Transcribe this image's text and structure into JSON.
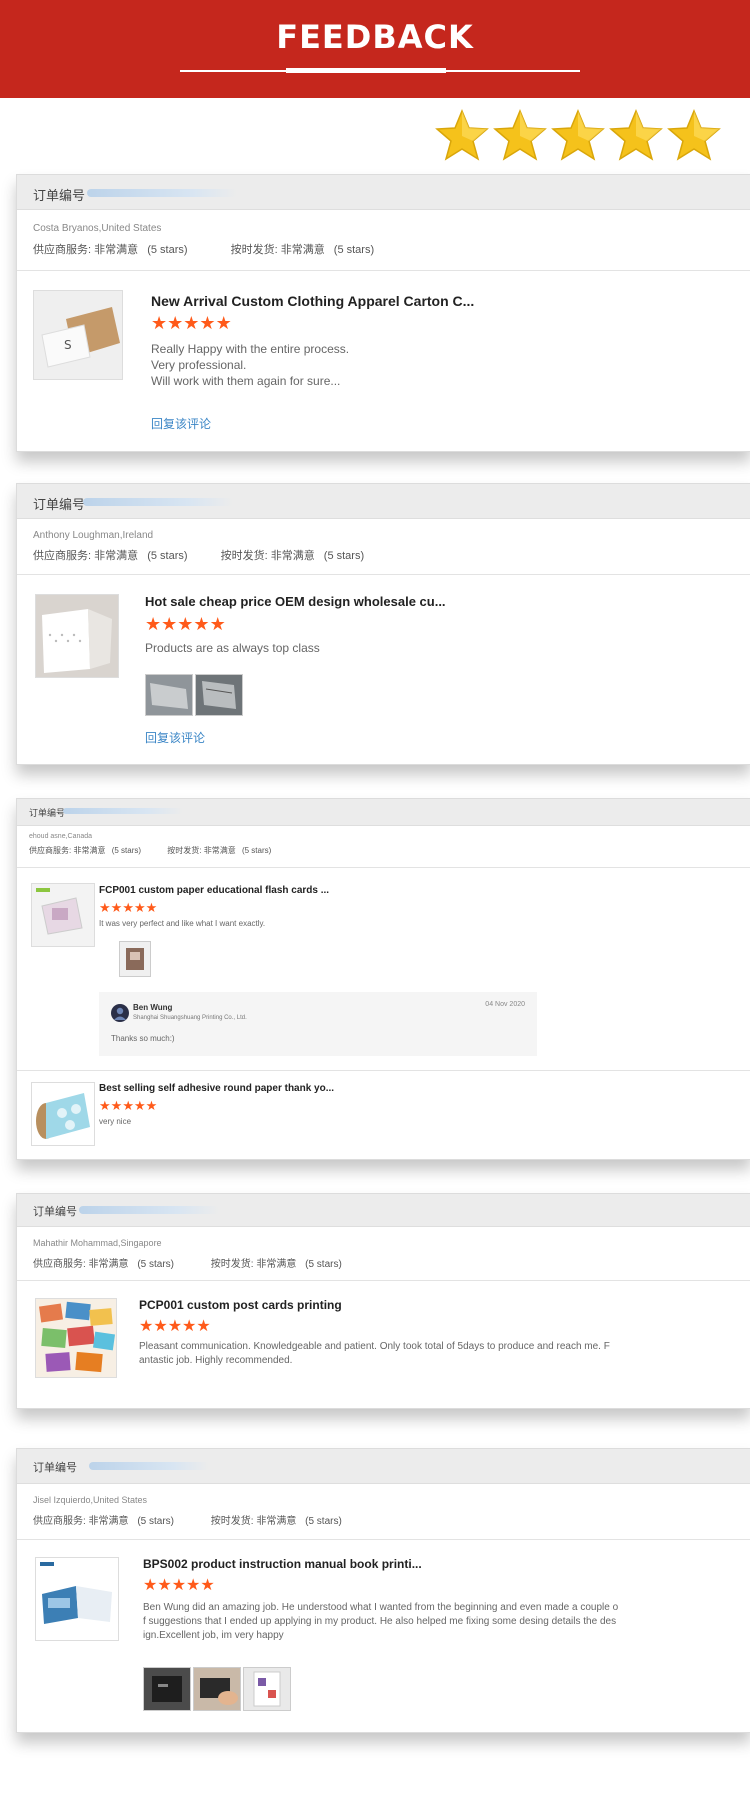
{
  "header": {
    "title": "FEEDBACK"
  },
  "colors": {
    "banner": "#c5271d",
    "star_gold": "#f5c21b",
    "star_orange": "#ff5a1a",
    "link": "#3b86c6"
  },
  "overall_rating": {
    "stars": 5,
    "max": 5
  },
  "order_label": "订单编号",
  "reviews": [
    {
      "buyer": "Costa Bryanos,United States",
      "supplier_service": "供应商服务: 非常满意",
      "supplier_stars": "(5 stars)",
      "shipping": "按时发货: 非常满意",
      "shipping_stars": "(5 stars)",
      "products": [
        {
          "title": "New Arrival Custom Clothing Apparel Carton C...",
          "rating": 5,
          "text": "Really Happy with the entire process.\nVery professional.\nWill work with them again for sure...",
          "thumb_icon": "carton-box-photo"
        }
      ],
      "reply_link": "回复该评论"
    },
    {
      "buyer": "Anthony Loughman,Ireland",
      "supplier_service": "供应商服务: 非常满意",
      "supplier_stars": "(5 stars)",
      "shipping": "按时发货: 非常满意",
      "shipping_stars": "(5 stars)",
      "products": [
        {
          "title": "Hot sale cheap price OEM design wholesale cu...",
          "rating": 5,
          "text": "Products are as always top class",
          "thumb_icon": "white-bag-photo"
        }
      ],
      "reply_link": "回复该评论"
    },
    {
      "buyer": "ehoud asne,Canada",
      "supplier_service": "供应商服务: 非常满意",
      "supplier_stars": "(5 stars)",
      "shipping": "按时发货: 非常满意",
      "shipping_stars": "(5 stars)",
      "products": [
        {
          "title": "FCP001 custom paper educational flash cards ...",
          "rating": 5,
          "text": "It was very perfect and like what I want exactly.",
          "thumb_icon": "flash-cards-photo"
        },
        {
          "title": "Best selling self adhesive round paper thank yo...",
          "rating": 5,
          "text": "very nice",
          "thumb_icon": "sticker-roll-photo"
        }
      ],
      "supplier_reply": {
        "name": "Ben Wung",
        "company": "Shanghai Shuangshuang Printing Co., Ltd.",
        "date": "04 Nov 2020",
        "text": "Thanks so much:)"
      }
    },
    {
      "buyer": "Mahathir Mohammad,Singapore",
      "supplier_service": "供应商服务: 非常满意",
      "supplier_stars": "(5 stars)",
      "shipping": "按时发货: 非常满意",
      "shipping_stars": "(5 stars)",
      "products": [
        {
          "title": "PCP001 custom post cards printing",
          "rating": 5,
          "text": "Pleasant communication. Knowledgeable and patient. Only took total of 5days to produce and reach me. F\nantastic job. Highly recommended.",
          "thumb_icon": "postcards-photo"
        }
      ]
    },
    {
      "buyer": "Jisel Izquierdo,United States",
      "supplier_service": "供应商服务: 非常满意",
      "supplier_stars": "(5 stars)",
      "shipping": "按时发货: 非常满意",
      "shipping_stars": "(5 stars)",
      "products": [
        {
          "title": "BPS002 product instruction manual book printi...",
          "rating": 5,
          "text": "Ben Wung did an amazing job. He understood what I wanted from the beginning and even made a couple o\nf suggestions that I ended up applying in my product. He also helped me fixing some desing details the des\nign.Excellent job, im very happy",
          "thumb_icon": "manual-booklet-photo"
        }
      ]
    }
  ]
}
